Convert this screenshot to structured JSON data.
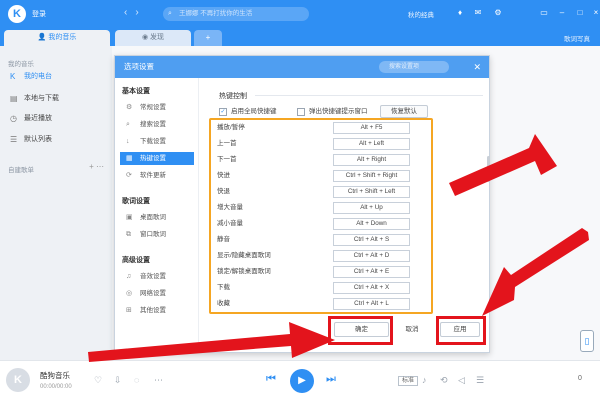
{
  "app": {
    "logo_letter": "K",
    "login_label": "登录",
    "search_placeholder": "王娜娜 不再打扰你的生活",
    "vip_label": "秋的经典",
    "brand_color": "#2f8ff3"
  },
  "tabs": [
    {
      "label": "我的音乐",
      "active": true
    },
    {
      "label": "发现",
      "active": false
    },
    {
      "label": "+",
      "active": false
    }
  ],
  "tab_right": "歌词写真",
  "sidebar": {
    "section_title": "我的音乐",
    "items": [
      {
        "label": "我的电台",
        "icon": "radio-icon",
        "active": true
      },
      {
        "label": "本地与下载",
        "icon": "download-icon",
        "active": false
      },
      {
        "label": "最近播放",
        "icon": "clock-icon",
        "active": false
      },
      {
        "label": "默认列表",
        "icon": "list-icon",
        "active": false
      }
    ],
    "playlist_header": "自建歌单",
    "add_label": "+",
    "more_label": "⋯"
  },
  "dialog": {
    "title": "选项设置",
    "search_placeholder": "搜索设置项",
    "close": "✕",
    "nav": {
      "groups": [
        {
          "title": "基本设置",
          "items": [
            {
              "label": "常规设置",
              "icon": "gear-icon",
              "active": false
            },
            {
              "label": "搜索设置",
              "icon": "search-icon",
              "active": false
            },
            {
              "label": "下载设置",
              "icon": "download-icon",
              "active": false
            },
            {
              "label": "热键设置",
              "icon": "keyboard-icon",
              "active": true
            },
            {
              "label": "软件更新",
              "icon": "update-icon",
              "active": false
            }
          ]
        },
        {
          "title": "歌词设置",
          "items": [
            {
              "label": "桌面歌词",
              "icon": "desktop-lyrics-icon",
              "active": false
            },
            {
              "label": "窗口歌词",
              "icon": "window-lyrics-icon",
              "active": false
            }
          ]
        },
        {
          "title": "高级设置",
          "items": [
            {
              "label": "音效设置",
              "icon": "equalizer-icon",
              "active": false
            },
            {
              "label": "网络设置",
              "icon": "network-icon",
              "active": false
            },
            {
              "label": "其他设置",
              "icon": "more-settings-icon",
              "active": false
            }
          ]
        }
      ]
    },
    "section_title": "热键控制",
    "checkbox_global": {
      "label": "启用全局快捷键",
      "checked": true
    },
    "checkbox_conflict": {
      "label": "弹出快捷键提示窗口",
      "checked": false
    },
    "restore_default": "恢复默认",
    "hotkeys": [
      {
        "action": "播放/暂停",
        "key": "Alt + F5"
      },
      {
        "action": "上一首",
        "key": "Alt + Left"
      },
      {
        "action": "下一首",
        "key": "Alt + Right"
      },
      {
        "action": "快进",
        "key": "Ctrl + Shift + Right"
      },
      {
        "action": "快退",
        "key": "Ctrl + Shift + Left"
      },
      {
        "action": "增大音量",
        "key": "Alt + Up"
      },
      {
        "action": "减小音量",
        "key": "Alt + Down"
      },
      {
        "action": "静音",
        "key": "Ctrl + Alt + S"
      },
      {
        "action": "显示/隐藏桌面歌词",
        "key": "Ctrl + Alt + D"
      },
      {
        "action": "锁定/解锁桌面歌词",
        "key": "Ctrl + Alt + E"
      },
      {
        "action": "下载",
        "key": "Ctrl + Alt + X"
      },
      {
        "action": "收藏",
        "key": "Ctrl + Alt + L"
      }
    ],
    "buttons": {
      "ok": "确定",
      "cancel": "取消",
      "apply": "应用"
    }
  },
  "player": {
    "song": "酷狗音乐",
    "time": "00:00/00:00",
    "quality": "标准",
    "volume": "0"
  },
  "annotation_colors": {
    "highlight": "#f5a623",
    "markup": "#e3141c"
  }
}
